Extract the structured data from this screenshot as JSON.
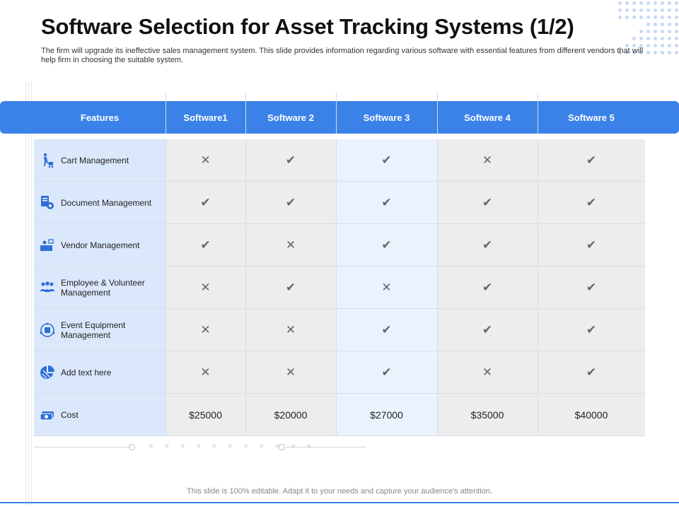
{
  "title": "Software Selection for Asset Tracking Systems (1/2)",
  "subtitle": "The firm will upgrade its ineffective sales management system. This slide provides information regarding various software with essential features from different vendors that will help firm in choosing the suitable system.",
  "headers": [
    "Features",
    "Software1",
    "Software 2",
    "Software 3",
    "Software 4",
    "Software 5"
  ],
  "rows": [
    {
      "label": "Cart Management",
      "icon": "cart-person-icon",
      "values": [
        "x",
        "check",
        "check",
        "x",
        "check"
      ]
    },
    {
      "label": "Document Management",
      "icon": "document-gear-icon",
      "values": [
        "check",
        "check",
        "check",
        "check",
        "check"
      ]
    },
    {
      "label": "Vendor Management",
      "icon": "vendor-desk-icon",
      "values": [
        "check",
        "x",
        "check",
        "check",
        "check"
      ]
    },
    {
      "label": "Employee & Volunteer Management",
      "icon": "people-group-icon",
      "values": [
        "x",
        "check",
        "x",
        "check",
        "check"
      ]
    },
    {
      "label": "Event Equipment Management",
      "icon": "equipment-icon",
      "values": [
        "x",
        "x",
        "check",
        "check",
        "check"
      ]
    },
    {
      "label": "Add text here",
      "icon": "pie-chart-icon",
      "values": [
        "x",
        "x",
        "check",
        "x",
        "check"
      ]
    },
    {
      "label": "Cost",
      "icon": "money-icon",
      "values": [
        "$25000",
        "$20000",
        "$27000",
        "$35000",
        "$40000"
      ]
    }
  ],
  "footer": "This slide is 100% editable. Adapt it to your needs and capture your audience's attention.",
  "colors": {
    "accent": "#3b82e8",
    "feature_bg": "#dbe8fb",
    "cell_bg": "#ededed",
    "highlight_bg": "#eaf2fd"
  }
}
